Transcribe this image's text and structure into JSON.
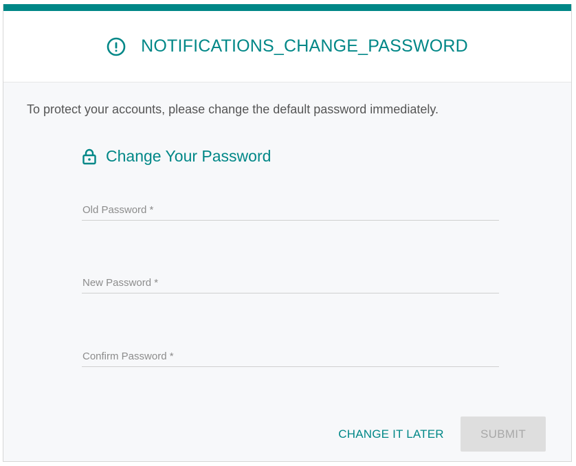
{
  "dialog": {
    "title": "NOTIFICATIONS_CHANGE_PASSWORD",
    "title_icon": "exclamation-circle-icon",
    "message": "To protect your accounts, please change the default password immediately.",
    "accent_color": "#008787"
  },
  "form": {
    "section_title": "Change Your Password",
    "section_icon": "lock-icon",
    "fields": [
      {
        "placeholder": "Old Password *",
        "value": ""
      },
      {
        "placeholder": "New Password *",
        "value": ""
      },
      {
        "placeholder": "Confirm Password *",
        "value": ""
      }
    ]
  },
  "actions": {
    "later_label": "CHANGE IT LATER",
    "submit_label": "SUBMIT",
    "submit_disabled": true
  }
}
